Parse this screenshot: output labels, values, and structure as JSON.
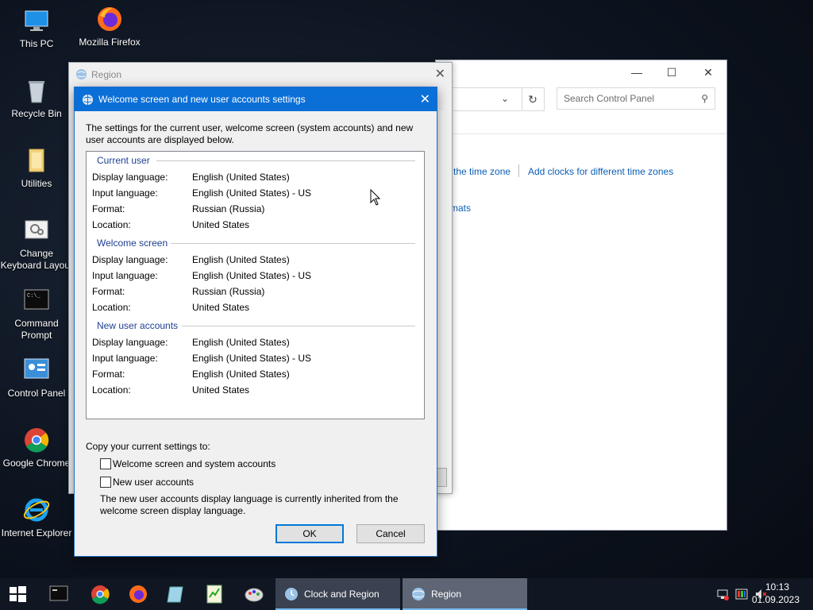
{
  "desktop": {
    "icons": [
      {
        "label": "This PC"
      },
      {
        "label": "Mozilla Firefox"
      },
      {
        "label": "Recycle Bin"
      },
      {
        "label": "Utilities"
      },
      {
        "label": "Change Keyboard Layout"
      },
      {
        "label": "Command Prompt"
      },
      {
        "label": "Control Panel"
      },
      {
        "label": "Google Chrome"
      },
      {
        "label": "Internet Explorer"
      }
    ]
  },
  "control_panel": {
    "search_placeholder": "Search Control Panel",
    "links": {
      "time_zone": "the time zone",
      "add_clocks": "Add clocks for different time zones",
      "formats": "mats"
    }
  },
  "region_window": {
    "title": "Region"
  },
  "dialog": {
    "title": "Welcome screen and new user accounts settings",
    "intro": "The settings for the current user, welcome screen (system accounts) and new user accounts are displayed below.",
    "groups": [
      {
        "heading": "Current user",
        "rows": [
          {
            "label": "Display language:",
            "value": "English (United States)"
          },
          {
            "label": "Input language:",
            "value": "English (United States) - US"
          },
          {
            "label": "Format:",
            "value": "Russian (Russia)"
          },
          {
            "label": "Location:",
            "value": "United States"
          }
        ]
      },
      {
        "heading": "Welcome screen",
        "rows": [
          {
            "label": "Display language:",
            "value": "English (United States)"
          },
          {
            "label": "Input language:",
            "value": "English (United States) - US"
          },
          {
            "label": "Format:",
            "value": "Russian (Russia)"
          },
          {
            "label": "Location:",
            "value": "United States"
          }
        ]
      },
      {
        "heading": "New user accounts",
        "rows": [
          {
            "label": "Display language:",
            "value": "English (United States)"
          },
          {
            "label": "Input language:",
            "value": "English (United States) - US"
          },
          {
            "label": "Format:",
            "value": "English (United States)"
          },
          {
            "label": "Location:",
            "value": "United States"
          }
        ]
      }
    ],
    "copy_label": "Copy your current settings to:",
    "checkboxes": [
      {
        "label": "Welcome screen and system accounts",
        "checked": false
      },
      {
        "label": "New user accounts",
        "checked": false
      }
    ],
    "note": "The new user accounts display language is currently inherited from the welcome screen display language.",
    "ok_label": "OK",
    "cancel_label": "Cancel"
  },
  "taskbar": {
    "tasks": [
      {
        "label": "Clock and Region"
      },
      {
        "label": "Region"
      }
    ],
    "time": "10:13",
    "date": "01.09.2023"
  },
  "colors": {
    "titlebar": "#0a6fd7",
    "link": "#0b5fb5",
    "group_heading": "#1e3f91",
    "taskbar": "#101722"
  }
}
